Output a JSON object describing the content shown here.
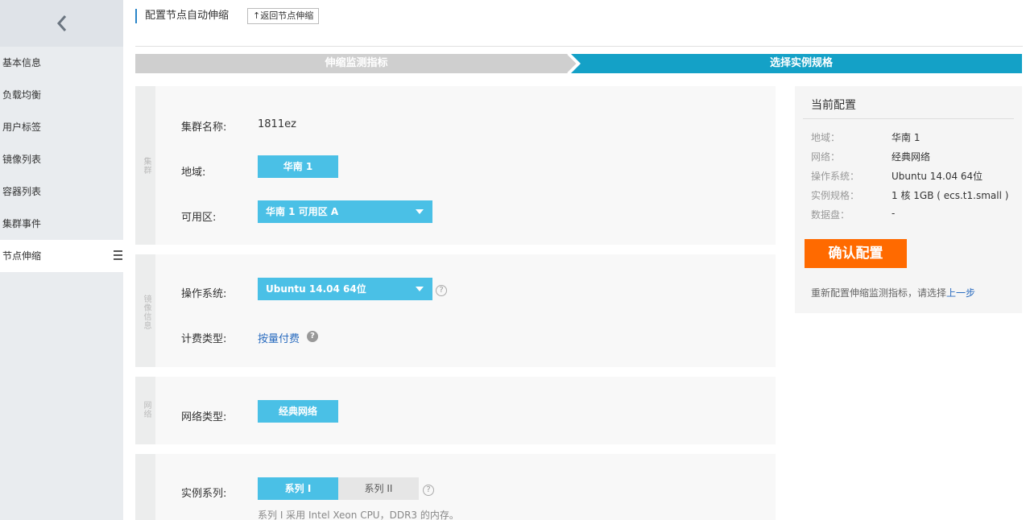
{
  "sidebar": {
    "back_icon": "chevron-left-icon",
    "items": [
      {
        "label": "基本信息"
      },
      {
        "label": "负载均衡"
      },
      {
        "label": "用户标签"
      },
      {
        "label": "镜像列表"
      },
      {
        "label": "容器列表"
      },
      {
        "label": "集群事件"
      },
      {
        "label": "节点伸缩",
        "active": true
      }
    ]
  },
  "header": {
    "title": "配置节点自动伸缩",
    "return_button": "↑返回节点伸缩"
  },
  "steps": {
    "step1": "伸缩监测指标",
    "step2": "选择实例规格",
    "colors": {
      "done": "#cfcfcf",
      "active": "#14a1c7"
    }
  },
  "cluster_section": {
    "tab_label": "集群",
    "name_label": "集群名称:",
    "name_value": "1811ez",
    "region_label": "地域:",
    "region_value": "华南 1",
    "zone_label": "可用区:",
    "zone_value": "华南 1 可用区 A"
  },
  "image_section": {
    "tab_label": "镜像信息",
    "os_label": "操作系统:",
    "os_value": "Ubuntu 14.04 64位",
    "billing_label": "计费类型:",
    "billing_value": "按量付费"
  },
  "network_section": {
    "tab_label": "网络",
    "type_label": "网络类型:",
    "type_value": "经典网络"
  },
  "instance_section": {
    "series_label": "实例系列:",
    "series_options": [
      "系列 I",
      "系列 II"
    ],
    "selected": "系列 I",
    "note": "系列 I 采用 Intel Xeon CPU，DDR3 的内存。"
  },
  "summary": {
    "title": "当前配置",
    "rows": [
      {
        "key": "地域：",
        "value": "华南 1"
      },
      {
        "key": "网络：",
        "value": "经典网络"
      },
      {
        "key": "操作系统：",
        "value": "Ubuntu 14.04 64位"
      },
      {
        "key": "实例规格：",
        "value": "1 核 1GB ( ecs.t1.small )"
      },
      {
        "key": "数据盘：",
        "value": "-"
      }
    ],
    "confirm_button": "确认配置",
    "hint_prefix": "重新配置伸缩监测指标，请选择",
    "hint_link": "上一步"
  },
  "colors": {
    "accent_blue": "#4ac0e6",
    "confirm_orange": "#ff6a00",
    "link_blue": "#2a6cbf"
  }
}
